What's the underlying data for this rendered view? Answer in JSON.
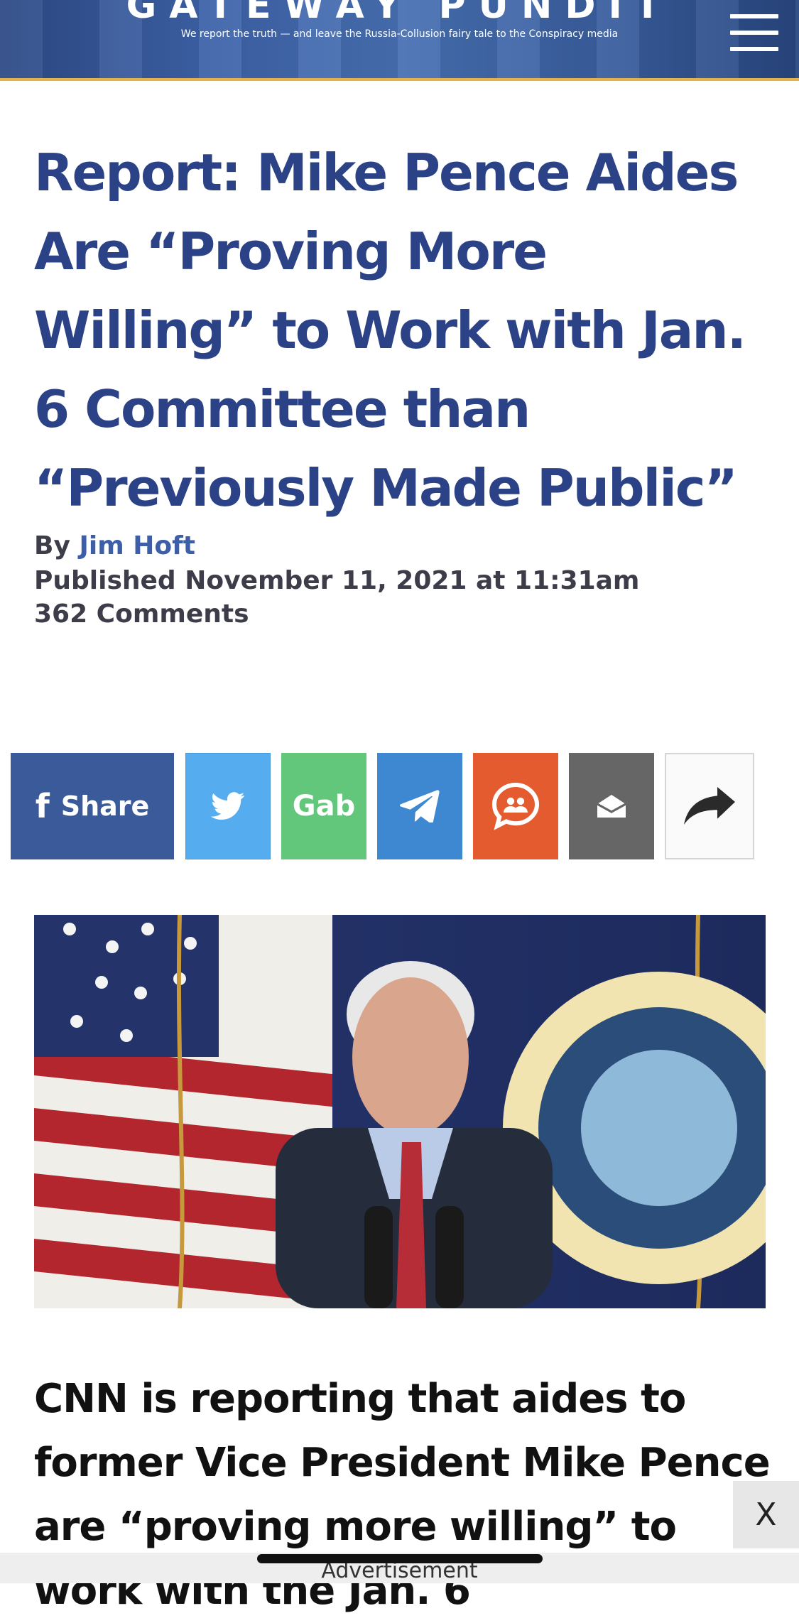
{
  "header": {
    "logo": "GATEWAY PUNDIT",
    "tagline": "We report the truth — and leave the Russia-Collusion fairy tale to the Conspiracy media",
    "menu_icon": "hamburger-menu-icon"
  },
  "article": {
    "headline": "Report: Mike Pence Aides Are “Proving More Willing” to Work with Jan. 6 Committee than “Previously Made Public”",
    "by_label": "By",
    "author": "Jim Hoft",
    "published": "Published November 11, 2021 at 11:31am",
    "comments": "362 Comments",
    "photo_icon": "article-photo",
    "body_start": "CNN is reporting that aides to former Vice President Mike Pence are “proving more willing” to work with the Jan. 6"
  },
  "share": {
    "facebook_label": "Share",
    "gab_label": "Gab",
    "icons": [
      "facebook-icon",
      "twitter-icon",
      "telegram-icon",
      "mewe-icon",
      "email-icon",
      "share-arrow-icon"
    ],
    "colors": {
      "facebook": "#3b5a99",
      "twitter": "#55acee",
      "gab": "#63c77b",
      "telegram": "#3d88d0",
      "mewe": "#e35b2e",
      "email": "#666666"
    }
  },
  "ad": {
    "close_label": "X",
    "label": "Advertisement"
  },
  "colors": {
    "headline": "#2b4287",
    "header_bg": "#3d62a8",
    "header_border": "#e3b34a"
  }
}
